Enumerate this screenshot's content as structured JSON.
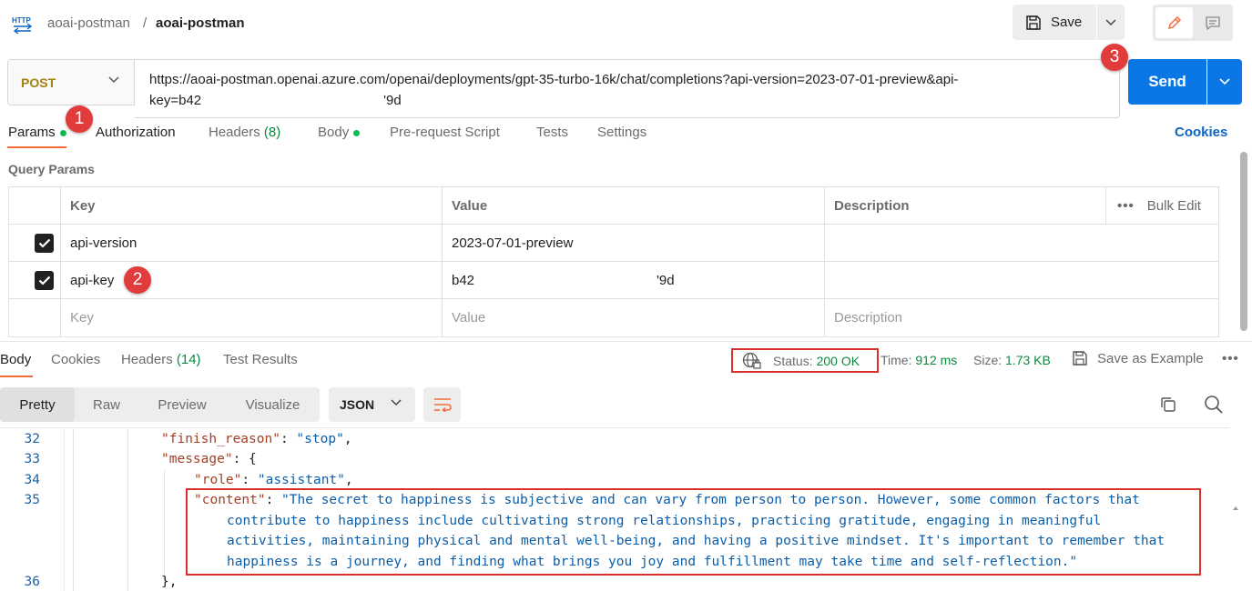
{
  "header": {
    "breadcrumb_parent": "aoai-postman",
    "breadcrumb_sep": "/",
    "breadcrumb_current": "aoai-postman",
    "save_label": "Save"
  },
  "request": {
    "method": "POST",
    "url_line1": "https://aoai-postman.openai.azure.com/openai/deployments/gpt-35-turbo-16k/chat/completions?api-version=2023-07-01-preview&api-",
    "url_line2": "key=b42                                                '9d",
    "send_label": "Send"
  },
  "markers": [
    "1",
    "2",
    "3"
  ],
  "tabs": {
    "params": "Params",
    "authorization": "Authorization",
    "headers": "Headers",
    "headers_count": "(8)",
    "body": "Body",
    "prerequest": "Pre-request Script",
    "tests": "Tests",
    "settings": "Settings",
    "cookies": "Cookies"
  },
  "query_params": {
    "title": "Query Params",
    "columns": {
      "key": "Key",
      "value": "Value",
      "description": "Description",
      "bulk_edit": "Bulk Edit",
      "more": "•••"
    },
    "rows": [
      {
        "key": "api-version",
        "value": "2023-07-01-preview",
        "description": ""
      },
      {
        "key": "api-key",
        "value": "b42                                                '9d",
        "description": ""
      }
    ],
    "placeholders": {
      "key": "Key",
      "value": "Value",
      "description": "Description"
    }
  },
  "response": {
    "tabs": {
      "body": "Body",
      "cookies": "Cookies",
      "headers": "Headers",
      "headers_count": "(14)",
      "test_results": "Test Results"
    },
    "status_label": "Status:",
    "status_value": "200 OK",
    "time_label": "Time:",
    "time_value": "912 ms",
    "size_label": "Size:",
    "size_value": "1.73 KB",
    "save_example": "Save as Example",
    "more": "•••",
    "views": {
      "pretty": "Pretty",
      "raw": "Raw",
      "preview": "Preview",
      "visualize": "Visualize"
    },
    "format": "JSON"
  },
  "code": {
    "line_numbers": [
      "32",
      "33",
      "34",
      "35",
      "36"
    ],
    "l32_key": "\"finish_reason\"",
    "l32_rest": ": ",
    "l32_val": "\"stop\"",
    "l32_end": ",",
    "l33_key": "\"message\"",
    "l33_rest": ": {",
    "l34_key": "\"role\"",
    "l34_rest": ": ",
    "l34_val": "\"assistant\"",
    "l34_end": ",",
    "l35_key": "\"content\"",
    "l35_rest": ": ",
    "l35_val_1": "\"The secret to happiness is subjective and can vary from person to person. However, some common factors that",
    "l35_val_2": "contribute to happiness include cultivating strong relationships, practicing gratitude, engaging in meaningful",
    "l35_val_3": "activities, maintaining physical and mental well-being, and having a positive mindset. It's important to remember that",
    "l35_val_4": "happiness is a journey, and finding what brings you joy and fulfillment may take time and self-reflection.\"",
    "l36": "},"
  },
  "colors": {
    "accent_orange": "#f26b3a",
    "send_blue": "#0b77e6",
    "status_green": "#0a8a3e",
    "marker_red": "#e23b3b",
    "method_post": "#a4800d"
  }
}
